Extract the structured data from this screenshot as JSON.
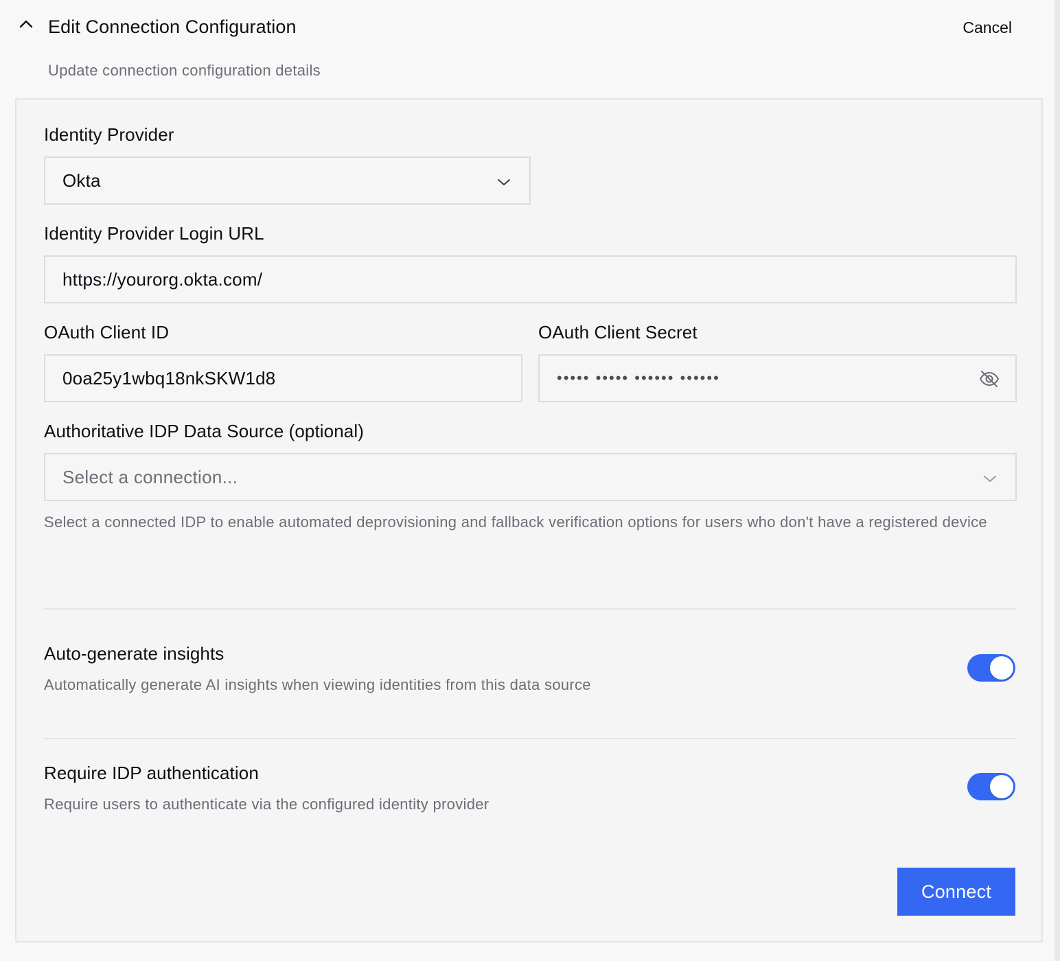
{
  "header": {
    "title": "Edit Connection Configuration",
    "subtitle": "Update connection configuration details",
    "cancel_label": "Cancel",
    "collapse_icon": "chevron-up-icon"
  },
  "form": {
    "identity_provider": {
      "label": "Identity Provider",
      "value": "Okta",
      "icon": "chevron-down-icon"
    },
    "login_url": {
      "label": "Identity Provider Login URL",
      "value": "https://yourorg.okta.com/"
    },
    "client_id": {
      "label": "OAuth Client ID",
      "value": "0oa25y1wbq18nkSKW1d8"
    },
    "client_secret": {
      "label": "OAuth Client Secret",
      "masked_value": "••••• ••••• •••••• ••••••",
      "icon": "eye-off-icon"
    },
    "data_source": {
      "label": "Authoritative IDP Data Source (optional)",
      "placeholder": "Select a connection...",
      "help": "Select a connected IDP to enable automated deprovisioning and fallback verification options for users who don't have a registered device",
      "icon": "chevron-down-icon"
    }
  },
  "settings": [
    {
      "title": "Auto-generate insights",
      "description": "Automatically generate AI insights when viewing identities from this data source",
      "enabled": true
    },
    {
      "title": "Require IDP authentication",
      "description": "Require users to authenticate via the configured identity provider",
      "enabled": true
    }
  ],
  "actions": {
    "connect_label": "Connect"
  },
  "colors": {
    "accent": "#3468f2",
    "muted_text": "#6b6e76",
    "border": "#dcdce0"
  }
}
